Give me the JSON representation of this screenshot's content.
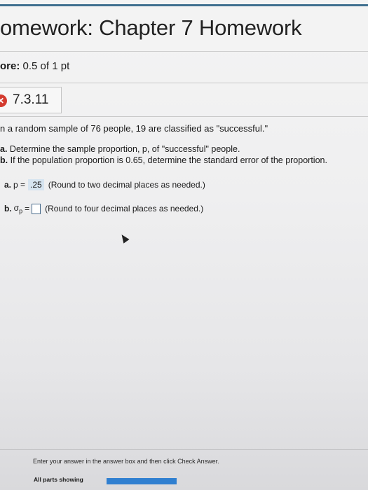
{
  "header": {
    "title": "omework: Chapter 7 Homework"
  },
  "score": {
    "label": "ore:",
    "value": "0.5 of 1 pt"
  },
  "question": {
    "number": "7.3.11",
    "status_icon": "incorrect-x-icon",
    "prompt": "n a random sample of 76 people, 19 are classified as \"successful.\"",
    "part_a": {
      "letter": "a.",
      "text": "Determine the sample proportion, p, of \"successful\" people."
    },
    "part_b": {
      "letter": "b.",
      "text": "If the population proportion is 0.65, determine the standard error of the proportion."
    }
  },
  "answers": {
    "a": {
      "label": "a.",
      "symbol": "p =",
      "value": ".25",
      "hint": "(Round to two decimal places as needed.)"
    },
    "b": {
      "label": "b.",
      "symbol": "σ",
      "subscript": "p",
      "equals": "=",
      "value": "",
      "hint": "(Round to four decimal places as needed.)"
    }
  },
  "footer": {
    "instruction": "Enter your answer in the answer box and then click Check Answer.",
    "parts_label": "All parts showing",
    "progress_fraction": 1.0
  },
  "colors": {
    "accent_rule": "#3f6f8f",
    "incorrect": "#d43b2f",
    "answer_highlight": "#d6e4f0",
    "progress": "#2f7fd0"
  }
}
